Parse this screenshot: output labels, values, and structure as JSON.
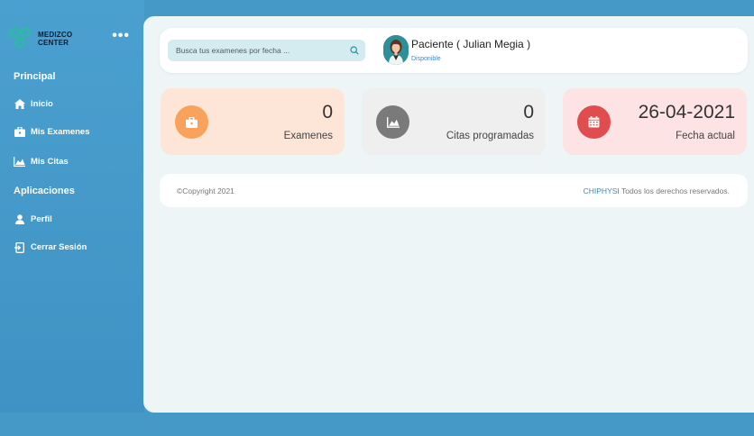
{
  "brand": {
    "name_line1": "MEDIZCO",
    "name_line2": "CENTER",
    "teal": "#2fb8a8"
  },
  "colors": {
    "sidebar": "#4499c7",
    "main_bg": "#eef5f7",
    "accent_link": "#3a8bc8"
  },
  "sidebar": {
    "menu_icon": "more-dots-icon",
    "sections": [
      {
        "title": "Principal",
        "items": [
          {
            "label": "Inicio",
            "icon": "home-icon"
          },
          {
            "label": "Mis Examenes",
            "icon": "briefcase-icon"
          },
          {
            "label": "Mis Citas",
            "icon": "area-chart-icon"
          }
        ]
      },
      {
        "title": "Aplicaciones",
        "items": [
          {
            "label": "Perfil",
            "icon": "user-icon"
          },
          {
            "label": "Cerrar Sesión",
            "icon": "logout-icon"
          }
        ]
      }
    ]
  },
  "header": {
    "search": {
      "placeholder": "Busca tus examenes por fecha ...",
      "icon": "search-icon"
    },
    "user": {
      "name": "Paciente ( Julian Megia )",
      "status": "Disponible"
    }
  },
  "cards": [
    {
      "value": "0",
      "label": "Examenes",
      "icon": "briefcase-icon",
      "bg": "#fde5d8",
      "circle": "#f9a25c"
    },
    {
      "value": "0",
      "label": "Citas programadas",
      "icon": "area-chart-icon",
      "bg": "#efefef",
      "circle": "#7a7a7a"
    },
    {
      "value": "26-04-2021",
      "label": "Fecha actual",
      "icon": "calendar-icon",
      "bg": "#fde3e3",
      "circle": "#e04d4f"
    }
  ],
  "footer": {
    "copyright": "©Copyright 2021",
    "brand_link": "CHIPHYSI",
    "rights": " Todos los derechos reservados."
  }
}
